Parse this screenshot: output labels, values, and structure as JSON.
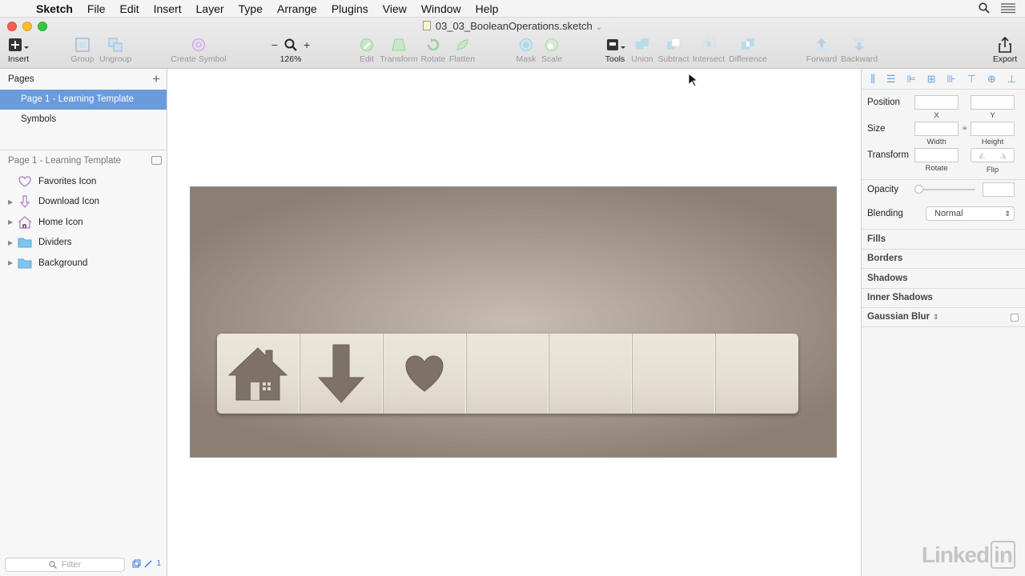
{
  "menubar": {
    "app_name": "Sketch",
    "items": [
      "File",
      "Edit",
      "Insert",
      "Layer",
      "Type",
      "Arrange",
      "Plugins",
      "View",
      "Window",
      "Help"
    ]
  },
  "window": {
    "title": "03_03_BooleanOperations.sketch"
  },
  "toolbar": {
    "insert": "Insert",
    "group": "Group",
    "ungroup": "Ungroup",
    "create_symbol": "Create Symbol",
    "zoom_minus": "−",
    "zoom_plus": "+",
    "zoom_level": "126%",
    "edit": "Edit",
    "transform": "Transform",
    "rotate": "Rotate",
    "flatten": "Flatten",
    "mask": "Mask",
    "scale": "Scale",
    "tools": "Tools",
    "union": "Union",
    "subtract": "Subtract",
    "intersect": "Intersect",
    "difference": "Difference",
    "forward": "Forward",
    "backward": "Backward",
    "export": "Export"
  },
  "pages": {
    "header": "Pages",
    "items": [
      {
        "label": "Page 1 - Learning Template",
        "selected": true
      },
      {
        "label": "Symbols",
        "selected": false
      }
    ]
  },
  "layers": {
    "header": "Page 1 - Learning Template",
    "items": [
      {
        "label": "Favorites Icon",
        "icon": "heart-icon"
      },
      {
        "label": "Download Icon",
        "icon": "download-arrow-icon"
      },
      {
        "label": "Home Icon",
        "icon": "home-icon"
      },
      {
        "label": "Dividers",
        "icon": "folder-icon"
      },
      {
        "label": "Background",
        "icon": "folder-icon"
      }
    ],
    "filter_placeholder": "Filter",
    "footer_count": "1"
  },
  "inspector": {
    "position_label": "Position",
    "x_label": "X",
    "y_label": "Y",
    "size_label": "Size",
    "width_label": "Width",
    "height_label": "Height",
    "transform_label": "Transform",
    "rotate_label": "Rotate",
    "flip_label": "Flip",
    "opacity_label": "Opacity",
    "blending_label": "Blending",
    "blending_value": "Normal",
    "sections": [
      "Fills",
      "Borders",
      "Shadows",
      "Inner Shadows",
      "Gaussian Blur"
    ]
  },
  "watermark": {
    "text": "Linked",
    "in": "in"
  },
  "colors": {
    "selection": "#6a9bdc",
    "icon_fill": "#7d7168",
    "accent_blue": "#6aa2e0"
  }
}
